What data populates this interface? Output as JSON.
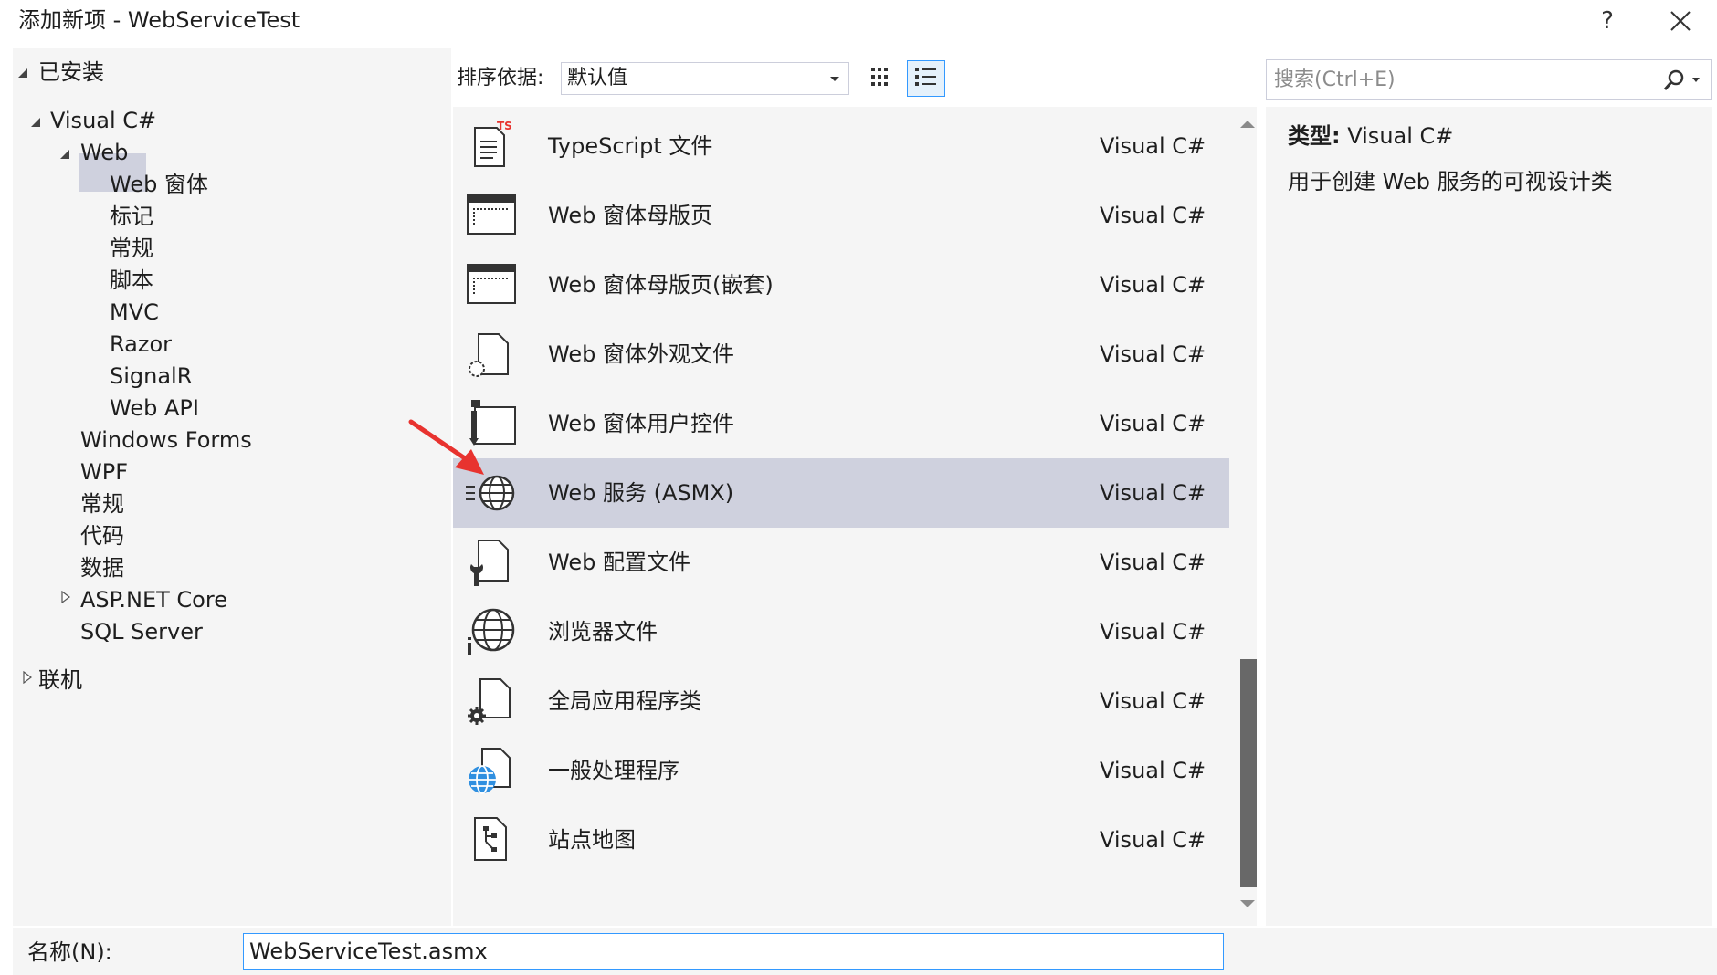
{
  "window": {
    "title": "添加新项 - WebServiceTest",
    "help_label": "?",
    "close_icon": "close-icon"
  },
  "left_tree": {
    "installed_label": "已安装",
    "online_label": "联机",
    "items": [
      {
        "label": "Visual C#",
        "expanded": true
      },
      {
        "label": "Web",
        "expanded": true,
        "selected": true
      },
      {
        "label": "Web 窗体"
      },
      {
        "label": "标记"
      },
      {
        "label": "常规"
      },
      {
        "label": "脚本"
      },
      {
        "label": "MVC"
      },
      {
        "label": "Razor"
      },
      {
        "label": "SignalR"
      },
      {
        "label": "Web API"
      },
      {
        "label": "Windows Forms"
      },
      {
        "label": "WPF"
      },
      {
        "label": "常规"
      },
      {
        "label": "代码"
      },
      {
        "label": "数据"
      },
      {
        "label": "ASP.NET Core",
        "expanded": false
      },
      {
        "label": "SQL Server"
      }
    ]
  },
  "toolbar": {
    "sort_label": "排序依据:",
    "sort_value": "默认值",
    "view_small_icon": "small-icons-view-icon",
    "view_list_icon": "list-view-icon"
  },
  "templates": [
    {
      "name": "TypeScript 文件",
      "lang": "Visual C#",
      "icon": "typescript-file-icon"
    },
    {
      "name": "Web 窗体母版页",
      "lang": "Visual C#",
      "icon": "master-page-icon"
    },
    {
      "name": "Web 窗体母版页(嵌套)",
      "lang": "Visual C#",
      "icon": "nested-master-page-icon"
    },
    {
      "name": "Web 窗体外观文件",
      "lang": "Visual C#",
      "icon": "skin-file-icon"
    },
    {
      "name": "Web 窗体用户控件",
      "lang": "Visual C#",
      "icon": "user-control-icon"
    },
    {
      "name": "Web 服务 (ASMX)",
      "lang": "Visual C#",
      "icon": "web-service-icon",
      "selected": true
    },
    {
      "name": "Web 配置文件",
      "lang": "Visual C#",
      "icon": "config-file-icon"
    },
    {
      "name": "浏览器文件",
      "lang": "Visual C#",
      "icon": "browser-file-icon"
    },
    {
      "name": "全局应用程序类",
      "lang": "Visual C#",
      "icon": "global-app-class-icon"
    },
    {
      "name": "一般处理程序",
      "lang": "Visual C#",
      "icon": "generic-handler-icon"
    },
    {
      "name": "站点地图",
      "lang": "Visual C#",
      "icon": "site-map-icon"
    }
  ],
  "search": {
    "placeholder": "搜索(Ctrl+E)",
    "value": ""
  },
  "details": {
    "type_label": "类型:",
    "type_value": "Visual C#",
    "description": "用于创建 Web 服务的可视设计类"
  },
  "name_field": {
    "label": "名称(N):",
    "value": "WebServiceTest.asmx"
  },
  "colors": {
    "selection": "#cfd1de",
    "panel": "#f5f5f5",
    "focus_border": "#3399ff",
    "annotation_arrow": "#e8332f"
  }
}
